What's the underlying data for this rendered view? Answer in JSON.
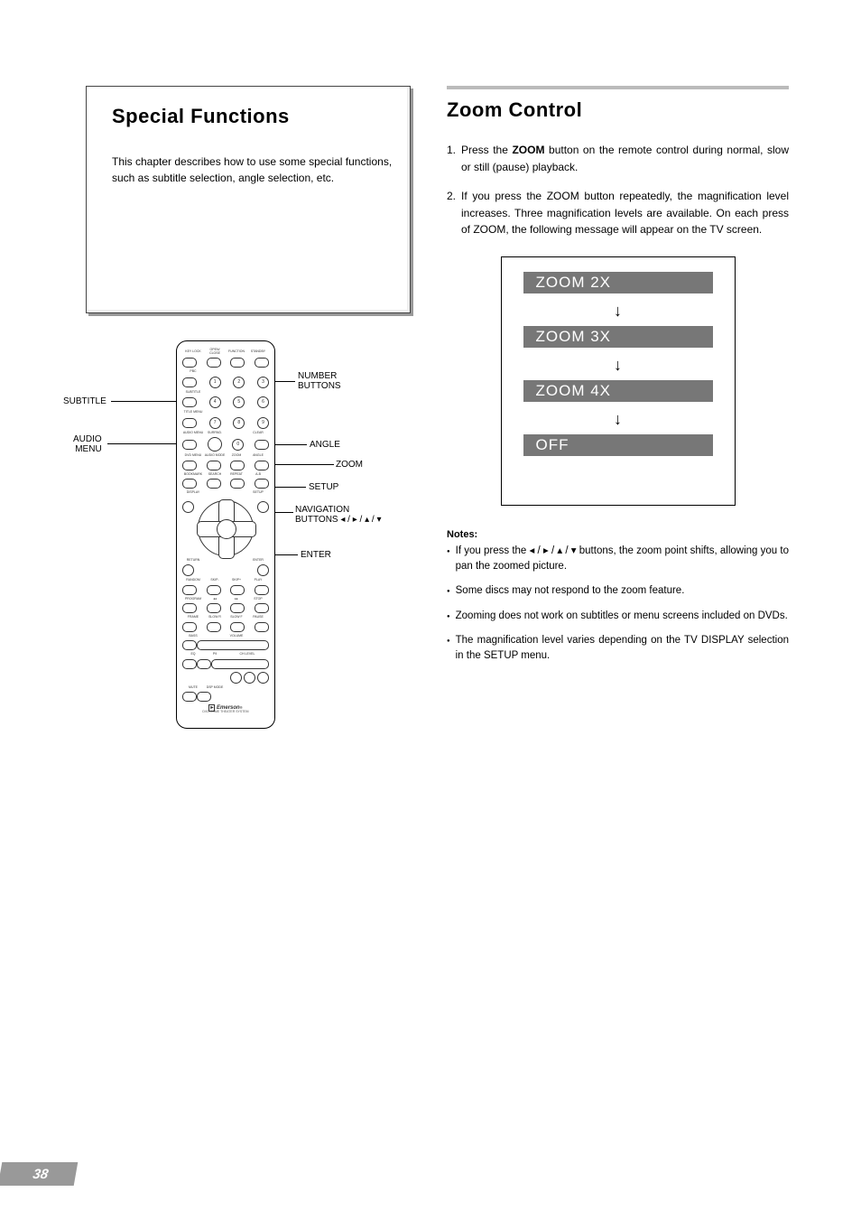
{
  "page_number": "38",
  "left": {
    "heading": "Special Functions",
    "intro": "This chapter describes how to use some special functions, such as subtitle selection, angle selection, etc."
  },
  "remote": {
    "brand_text": "Emerson",
    "brand_sub": "DVD HOME THEATER SYSTEM",
    "callouts_left": {
      "subtitle": "SUBTITLE",
      "audio_menu_line1": "AUDIO",
      "audio_menu_line2": "MENU"
    },
    "callouts_right": {
      "number_buttons_line1": "NUMBER",
      "number_buttons_line2": "BUTTONS",
      "angle": "ANGLE",
      "zoom": "ZOOM",
      "setup": "SETUP",
      "nav_line1": "NAVIGATION",
      "nav_line2": "BUTTONS ◂ / ▸ / ▴ / ▾",
      "enter": "ENTER"
    }
  },
  "right": {
    "heading": "Zoom Control",
    "steps": [
      {
        "num": "1.",
        "before": "Press the ",
        "bold": "ZOOM",
        "after": " button on the remote control during normal, slow or still (pause) playback."
      },
      {
        "num": "2.",
        "text": "If you press the ZOOM button repeatedly, the magnification level increases. Three magnification levels are available. On each press of ZOOM, the following message will appear on the TV screen."
      }
    ],
    "zoom_cycle": [
      "ZOOM 2X",
      "ZOOM 3X",
      "ZOOM 4X",
      "OFF"
    ],
    "notes_head": "Notes:",
    "notes": [
      {
        "before": "If you press the ",
        "arrows": "◂ / ▸ / ▴ / ▾",
        "after": " buttons, the zoom point shifts, allowing you to pan the zoomed picture."
      },
      {
        "text": "Some discs may not respond to the zoom feature."
      },
      {
        "text": "Zooming does not work on subtitles or menu screens included on DVDs."
      },
      {
        "text": "The magnification level varies depending on the TV DISPLAY selection in the SETUP menu."
      }
    ]
  }
}
